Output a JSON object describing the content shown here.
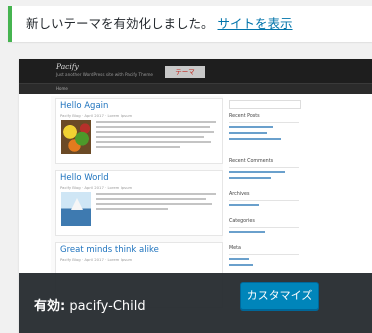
{
  "notice": {
    "message": "新しいテーマを有効化しました。",
    "link_text": "サイトを表示"
  },
  "preview": {
    "logo": "Pacify",
    "tagline": "Just another WordPress site with Pacify Theme",
    "label": "テーマ",
    "nav_home": "Home",
    "posts": [
      {
        "title": "Hello Again",
        "meta": "Pacify Blog  ·  April 2017  ·  Lorem Ipsum"
      },
      {
        "title": "Hello World",
        "meta": "Pacify Blog  ·  April 2017  ·  Lorem Ipsum"
      },
      {
        "title": "Great minds think alike",
        "meta": "Pacify Blog  ·  April 2017  ·  Lorem Ipsum"
      }
    ],
    "sidebar": {
      "recent_posts": "Recent Posts",
      "recent_comments": "Recent Comments",
      "archives": "Archives",
      "categories": "Categories",
      "meta": "Meta"
    }
  },
  "active_theme": {
    "prefix": "有効:",
    "name": "pacify-Child"
  },
  "customize_label": "カスタマイズ",
  "colors": {
    "notice_border": "#46b450",
    "link": "#0073aa",
    "button": "#0085ba",
    "overlay": "#23282d"
  }
}
